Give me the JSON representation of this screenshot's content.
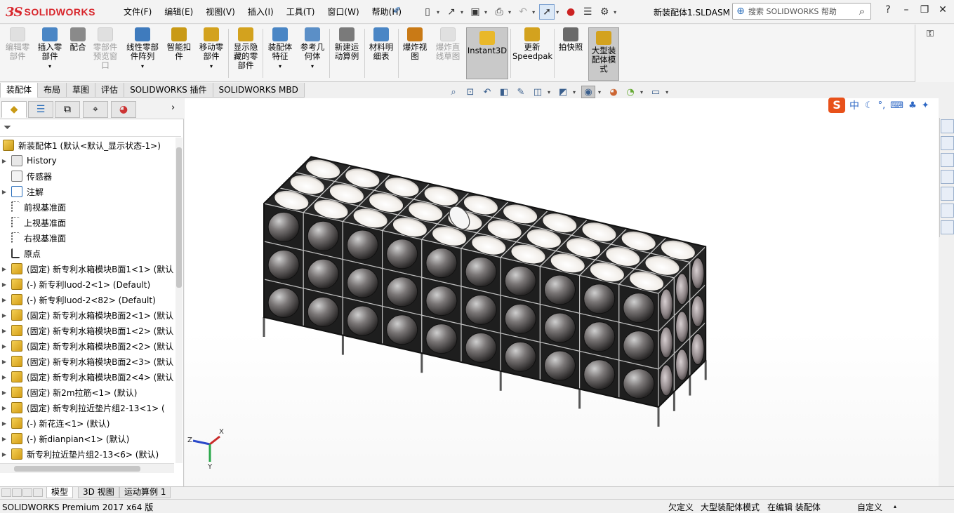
{
  "app": {
    "logo_ds": "3S",
    "logo_name": "SOLIDWORKS",
    "doc_title": "新装配体1.SLDASM"
  },
  "menus": [
    "文件(F)",
    "编辑(E)",
    "视图(V)",
    "插入(I)",
    "工具(T)",
    "窗口(W)",
    "帮助(H)"
  ],
  "search": {
    "placeholder": "搜索 SOLIDWORKS 帮助"
  },
  "commands": [
    {
      "label": "编辑零\n部件",
      "enabled": false,
      "color": "#b0b0b0"
    },
    {
      "label": "插入零\n部件",
      "enabled": true,
      "color": "#4a86c5",
      "dropdown": true
    },
    {
      "label": "配合",
      "enabled": true,
      "color": "#8a8a8a"
    },
    {
      "label": "零部件\n预览窗\n口",
      "enabled": false,
      "color": "#b0b0b0"
    },
    {
      "label": "线性零部\n件阵列",
      "enabled": true,
      "color": "#3f7bbd",
      "dropdown": true
    },
    {
      "label": "智能扣\n件",
      "enabled": true,
      "color": "#c99a16"
    },
    {
      "label": "移动零\n部件",
      "enabled": true,
      "color": "#d3a21e",
      "dropdown": true
    },
    {
      "label": "显示隐\n藏的零\n部件",
      "enabled": true,
      "color": "#d3a21e"
    },
    {
      "label": "装配体\n特征",
      "enabled": true,
      "color": "#4a86c5",
      "dropdown": true
    },
    {
      "label": "参考几\n何体",
      "enabled": true,
      "color": "#5b8fc7",
      "dropdown": true
    },
    {
      "label": "新建运\n动算例",
      "enabled": true,
      "color": "#7a7a7a"
    },
    {
      "label": "材料明\n细表",
      "enabled": true,
      "color": "#4a86c5"
    },
    {
      "label": "爆炸视\n图",
      "enabled": true,
      "color": "#c97a16"
    },
    {
      "label": "爆炸直\n线草图",
      "enabled": false,
      "color": "#b0b0b0"
    },
    {
      "label": "Instant3D",
      "enabled": true,
      "color": "#e9b82a",
      "pressed": true
    },
    {
      "label": "更新\nSpeedpak",
      "enabled": true,
      "color": "#d3a21e"
    },
    {
      "label": "拍快照",
      "enabled": true,
      "color": "#6a6a6a"
    },
    {
      "label": "大型装\n配体模\n式",
      "enabled": true,
      "color": "#d3a21e",
      "pressed": true
    }
  ],
  "tabs": [
    "装配体",
    "布局",
    "草图",
    "评估",
    "SOLIDWORKS 插件",
    "SOLIDWORKS MBD"
  ],
  "feature_tree": {
    "root": "新装配体1  (默认<默认_显示状态-1>)",
    "items": [
      {
        "label": "History",
        "icon": "history-icon",
        "expandable": true
      },
      {
        "label": "传感器",
        "icon": "sensor-icon",
        "expandable": false
      },
      {
        "label": "注解",
        "icon": "annotation-icon",
        "expandable": true
      },
      {
        "label": "前视基准面",
        "icon": "plane-icon",
        "expandable": false
      },
      {
        "label": "上视基准面",
        "icon": "plane-icon",
        "expandable": false
      },
      {
        "label": "右视基准面",
        "icon": "plane-icon",
        "expandable": false
      },
      {
        "label": "原点",
        "icon": "origin-icon",
        "expandable": false
      },
      {
        "label": "(固定) 新专利水箱模块B面1<1> (默认",
        "icon": "component-icon",
        "expandable": true
      },
      {
        "label": "(-) 新专利luod-2<1> (Default)",
        "icon": "component-icon",
        "expandable": true
      },
      {
        "label": "(-) 新专利luod-2<82> (Default)",
        "icon": "component-icon",
        "expandable": true
      },
      {
        "label": "(固定) 新专利水箱模块B面2<1> (默认",
        "icon": "component-icon",
        "expandable": true
      },
      {
        "label": "(固定) 新专利水箱模块B面1<2> (默认",
        "icon": "component-icon",
        "expandable": true
      },
      {
        "label": "(固定) 新专利水箱模块B面2<2> (默认",
        "icon": "component-icon",
        "expandable": true
      },
      {
        "label": "(固定) 新专利水箱模块B面2<3> (默认",
        "icon": "component-icon",
        "expandable": true
      },
      {
        "label": "(固定) 新专利水箱模块B面2<4> (默认",
        "icon": "component-icon",
        "expandable": true
      },
      {
        "label": "(固定) 新2m拉筋<1> (默认)",
        "icon": "component-icon",
        "expandable": true
      },
      {
        "label": "(固定) 新专利拉近垫片组2-13<1> (",
        "icon": "component-icon",
        "expandable": true
      },
      {
        "label": "(-) 新花连<1> (默认)",
        "icon": "component-icon",
        "expandable": true
      },
      {
        "label": "(-) 新dianpian<1> (默认)",
        "icon": "component-icon",
        "expandable": true
      },
      {
        "label": "新专利拉近垫片组2-13<6> (默认)",
        "icon": "component-icon",
        "expandable": true
      }
    ]
  },
  "triad": {
    "x": "X",
    "y": "Y",
    "z": "Z"
  },
  "ime": {
    "logo": "S",
    "mode": "中"
  },
  "bottom_tabs": [
    "模型",
    "3D 视图",
    "运动算例 1"
  ],
  "status": {
    "product": "SOLIDWORKS Premium 2017 x64 版",
    "state1": "欠定义",
    "state2": "大型装配体模式",
    "state3": "在编辑 装配体",
    "units": "自定义"
  }
}
